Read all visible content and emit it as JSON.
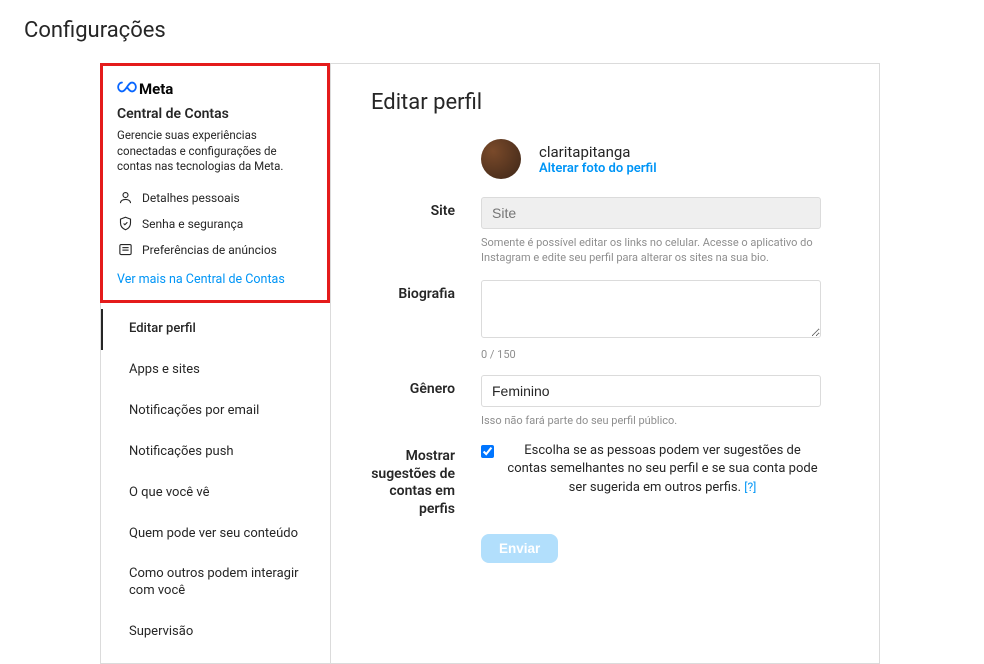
{
  "pageTitle": "Configurações",
  "sidebar": {
    "metaBrand": "Meta",
    "accountsCenterTitle": "Central de Contas",
    "accountsCenterDesc": "Gerencie suas experiências conectadas e configurações de contas nas tecnologias da Meta.",
    "items": [
      {
        "label": "Detalhes pessoais"
      },
      {
        "label": "Senha e segurança"
      },
      {
        "label": "Preferências de anúncios"
      }
    ],
    "moreLink": "Ver mais na Central de Contas",
    "nav": [
      "Editar perfil",
      "Apps e sites",
      "Notificações por email",
      "Notificações push",
      "O que você vê",
      "Quem pode ver seu conteúdo",
      "Como outros podem interagir com você",
      "Supervisão"
    ]
  },
  "content": {
    "heading": "Editar perfil",
    "username": "claritapitanga",
    "changePhoto": "Alterar foto do perfil",
    "siteLabel": "Site",
    "sitePlaceholder": "Site",
    "siteHelp": "Somente é possível editar os links no celular. Acesse o aplicativo do Instagram e edite seu perfil para alterar os sites na sua bio.",
    "bioLabel": "Biografia",
    "bioValue": "",
    "bioCounter": "0 / 150",
    "genderLabel": "Gênero",
    "genderValue": "Feminino",
    "genderHelp": "Isso não fará parte do seu perfil público.",
    "suggestLabel": "Mostrar sugestões de contas em perfis",
    "suggestText": "Escolha se as pessoas podem ver sugestões de contas semelhantes no seu perfil e se sua conta pode ser sugerida em outros perfis.",
    "qmark": "[?]",
    "submit": "Enviar"
  }
}
